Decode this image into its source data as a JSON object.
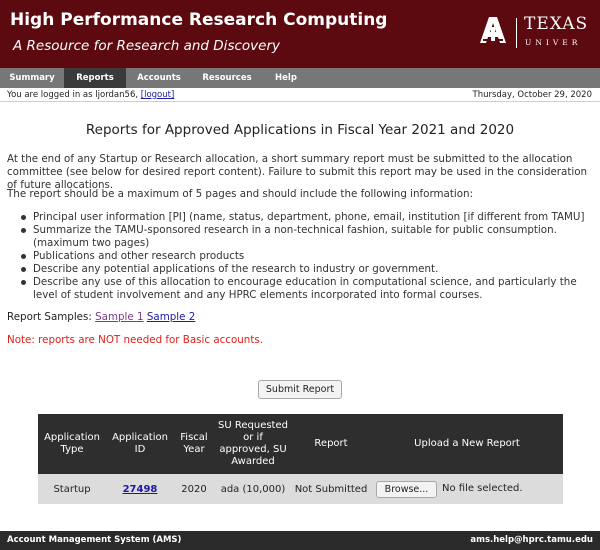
{
  "header": {
    "title": "High Performance Research Computing",
    "subtitle": "A Resource for Research and Discovery",
    "logo_name": "TEXAS",
    "logo_tag": "UNIVER"
  },
  "nav": {
    "items": [
      {
        "label": "Summary",
        "active": false
      },
      {
        "label": "Reports",
        "active": true
      },
      {
        "label": "Accounts",
        "active": false
      },
      {
        "label": "Resources",
        "active": false
      },
      {
        "label": "Help",
        "active": false
      }
    ]
  },
  "status": {
    "login_text": "You are logged in as ljordan56,",
    "logout_label": "[logout]",
    "date": "Thursday, October 29, 2020"
  },
  "main": {
    "title": "Reports for Approved Applications in Fiscal Year 2021 and 2020",
    "intro": "At the end of any Startup or Research allocation, a short summary report must be submitted to the allocation committee (see below for desired report content). Failure to submit this report may be used in the consideration of future allocations.",
    "requirements_intro": "The report should be a maximum of 5 pages and should include the following information:",
    "bullets": [
      "Principal user information [PI] (name, status, department, phone, email, institution [if different from TAMU]",
      "Summarize the TAMU-sponsored research in a non-technical fashion, suitable for public consumption. (maximum two pages)",
      "Publications and other research products",
      "Describe any potential applications of the research to industry or government.",
      "Describe any use of this allocation to encourage education in computational science, and particularly the level of student involvement and any HPRC elements incorporated into formal courses."
    ],
    "samples_label": "Report Samples:",
    "sample1": "Sample 1",
    "sample2": "Sample 2",
    "note": "Note: reports are NOT needed for Basic accounts.",
    "submit_label": "Submit Report"
  },
  "table": {
    "headers": [
      "Application Type",
      "Application ID",
      "Fiscal Year",
      "SU Requested or if approved, SU Awarded",
      "Report",
      "Upload a New Report"
    ],
    "rows": [
      {
        "type": "Startup",
        "id": "27498",
        "year": "2020",
        "su": "ada (10,000)",
        "report": "Not Submitted",
        "browse": "Browse...",
        "file_status": "No file selected."
      }
    ]
  },
  "footer": {
    "left": "Account Management System (AMS)",
    "right": "ams.help@hprc.tamu.edu"
  },
  "colors": {
    "banner": "#5c0a10",
    "nav": "#777777",
    "nav_active": "#3a3a3a",
    "visited_link": "#7a3a8c",
    "link": "#1a1aa6",
    "note": "#e0201a"
  }
}
